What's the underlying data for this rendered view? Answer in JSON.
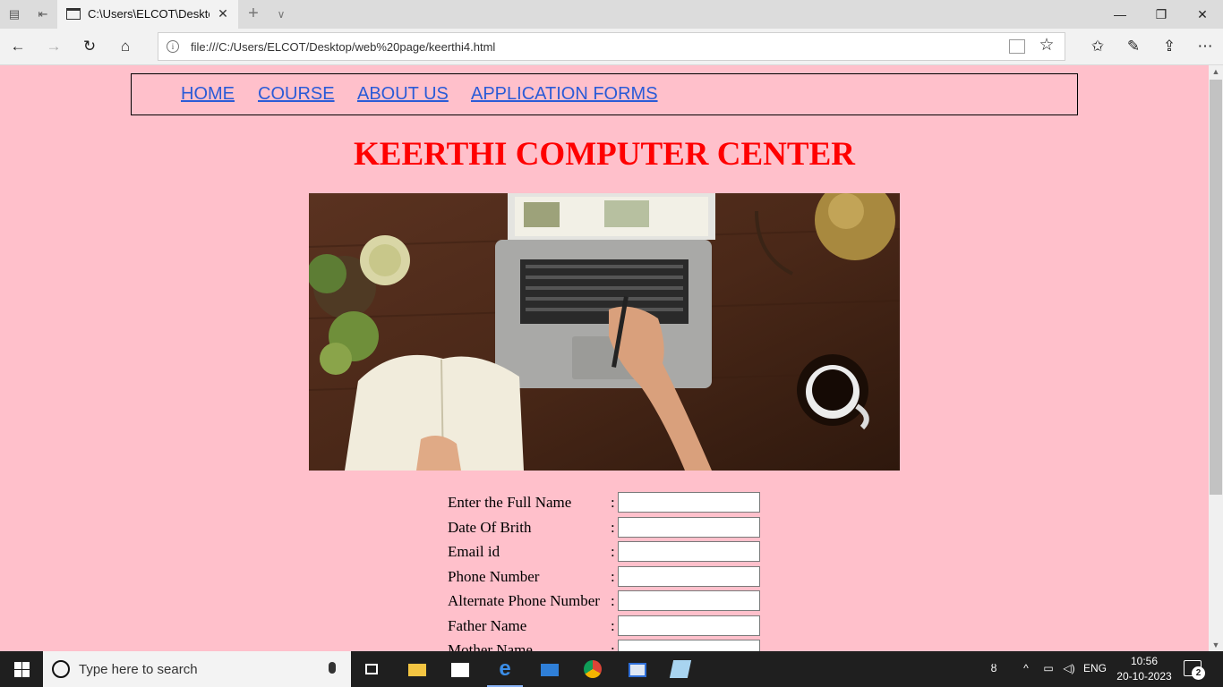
{
  "browser": {
    "tab_title": "C:\\Users\\ELCOT\\Desktop",
    "url": "file:///C:/Users/ELCOT/Desktop/web%20page/keerthi4.html"
  },
  "site_nav": {
    "items": [
      {
        "label": "HOME"
      },
      {
        "label": "COURSE"
      },
      {
        "label": "ABOUT US"
      },
      {
        "label": "APPLICATION FORMS"
      }
    ]
  },
  "page": {
    "title": "KEERTHI COMPUTER CENTER"
  },
  "form": {
    "fields": [
      {
        "label": "Enter the Full Name",
        "value": ""
      },
      {
        "label": "Date Of Brith",
        "value": ""
      },
      {
        "label": "Email id",
        "value": ""
      },
      {
        "label": "Phone Number",
        "value": ""
      },
      {
        "label": "Alternate Phone Number",
        "value": ""
      },
      {
        "label": "Father Name",
        "value": ""
      },
      {
        "label": "Mother Name",
        "value": ""
      }
    ],
    "separator": ":"
  },
  "taskbar": {
    "search_placeholder": "Type here to search",
    "language": "ENG",
    "time": "10:56",
    "date": "20-10-2023",
    "notification_count": "2"
  },
  "colors": {
    "page_background": "#ffc0cb",
    "title": "#ff0000",
    "link": "#2a5bd7"
  }
}
